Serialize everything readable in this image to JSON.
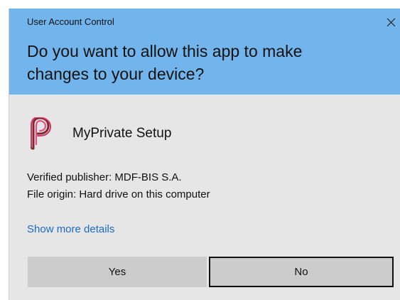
{
  "window": {
    "title": "User Account Control",
    "close_icon": "close-icon"
  },
  "header": {
    "question": "Do you want to allow this app to make changes to your device?",
    "background_color": "#72b5ec"
  },
  "app": {
    "icon": "paperclip-p-icon",
    "icon_color": "#d6306f",
    "name": "MyPrivate Setup"
  },
  "info": {
    "publisher": "Verified publisher: MDF-BIS S.A.",
    "origin": "File origin: Hard drive on this computer"
  },
  "details_link": "Show more details",
  "buttons": {
    "yes": "Yes",
    "no": "No"
  }
}
